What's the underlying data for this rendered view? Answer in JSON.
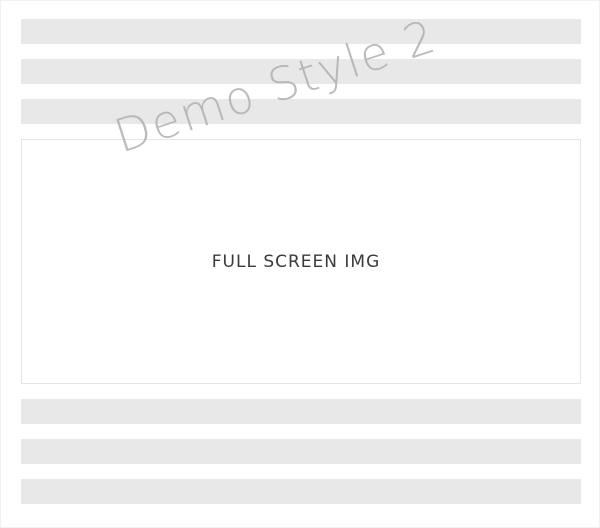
{
  "image_placeholder": {
    "label": "FULL SCREEN IMG"
  },
  "watermark": {
    "text": "Demo Style 2"
  },
  "colors": {
    "background": "#ffffff",
    "placeholder_bar": "#e8e8e8",
    "box_border": "#e6e6e6",
    "label_text": "#3a3a3a",
    "watermark_text": "#b0b0b0"
  }
}
